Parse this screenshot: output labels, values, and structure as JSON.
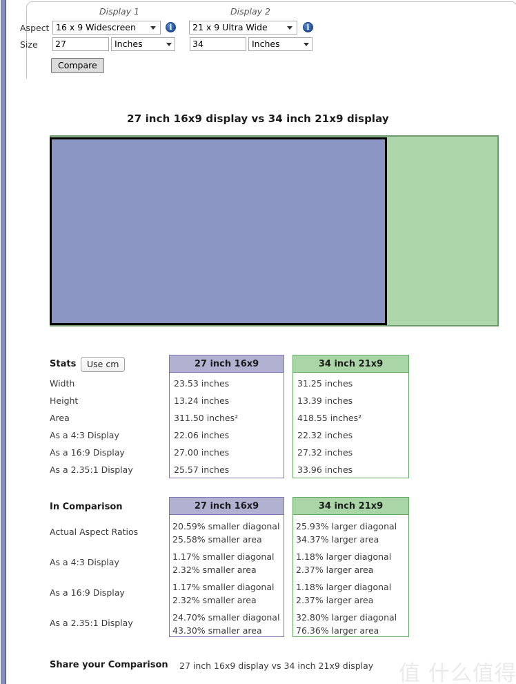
{
  "form": {
    "display1_label": "Display 1",
    "display2_label": "Display 2",
    "aspect_label": "Aspect",
    "size_label": "Size",
    "aspect1_value": "16 x 9 Widescreen",
    "aspect2_value": "21 x 9 Ultra Wide",
    "size1_value": "27",
    "size2_value": "34",
    "unit1_value": "Inches",
    "unit2_value": "Inches",
    "compare_button": "Compare",
    "info_icon_name": "info-icon"
  },
  "comparison_title": "27 inch 16x9 display vs 34 inch 21x9 display",
  "diagram": {
    "display1_color": "#8b96c4",
    "display1_border": "#000000",
    "display2_color": "#aed6ab",
    "display2_border": "#6d9a6d"
  },
  "stats": {
    "title": "Stats",
    "unit_toggle_label": "Use cm",
    "columns": [
      "27 inch 16x9",
      "34 inch 21x9"
    ],
    "rows": [
      {
        "label": "Width",
        "d1": "23.53 inches",
        "d2": "31.25 inches"
      },
      {
        "label": "Height",
        "d1": "13.24 inches",
        "d2": "13.39 inches"
      },
      {
        "label": "Area",
        "d1": "311.50 inches²",
        "d2": "418.55 inches²"
      },
      {
        "label": "As a 4:3 Display",
        "d1": "22.06 inches",
        "d2": "22.32 inches"
      },
      {
        "label": "As a 16:9 Display",
        "d1": "27.00 inches",
        "d2": "27.32 inches"
      },
      {
        "label": "As a 2.35:1 Display",
        "d1": "25.57 inches",
        "d2": "33.96 inches"
      }
    ]
  },
  "comparison": {
    "title": "In Comparison",
    "columns": [
      "27 inch 16x9",
      "34 inch 21x9"
    ],
    "rows": [
      {
        "label": "Actual Aspect Ratios",
        "d1_line1": "20.59% smaller diagonal",
        "d1_line2": "25.58% smaller area",
        "d2_line1": "25.93% larger diagonal",
        "d2_line2": "34.37% larger area"
      },
      {
        "label": "As a 4:3 Display",
        "d1_line1": "1.17% smaller diagonal",
        "d1_line2": "2.32% smaller area",
        "d2_line1": "1.18% larger diagonal",
        "d2_line2": "2.37% larger area"
      },
      {
        "label": "As a 16:9 Display",
        "d1_line1": "1.17% smaller diagonal",
        "d1_line2": "2.32% smaller area",
        "d2_line1": "1.18% larger diagonal",
        "d2_line2": "2.37% larger area"
      },
      {
        "label": "As a 2.35:1 Display",
        "d1_line1": "24.70% smaller diagonal",
        "d1_line2": "43.30% smaller area",
        "d2_line1": "32.80% larger diagonal",
        "d2_line2": "76.36% larger area"
      }
    ]
  },
  "share": {
    "title": "Share your Comparison",
    "text": "27 inch 16x9 display vs 34 inch 21x9 display"
  },
  "watermark": {
    "text": "值 什么值得买"
  }
}
